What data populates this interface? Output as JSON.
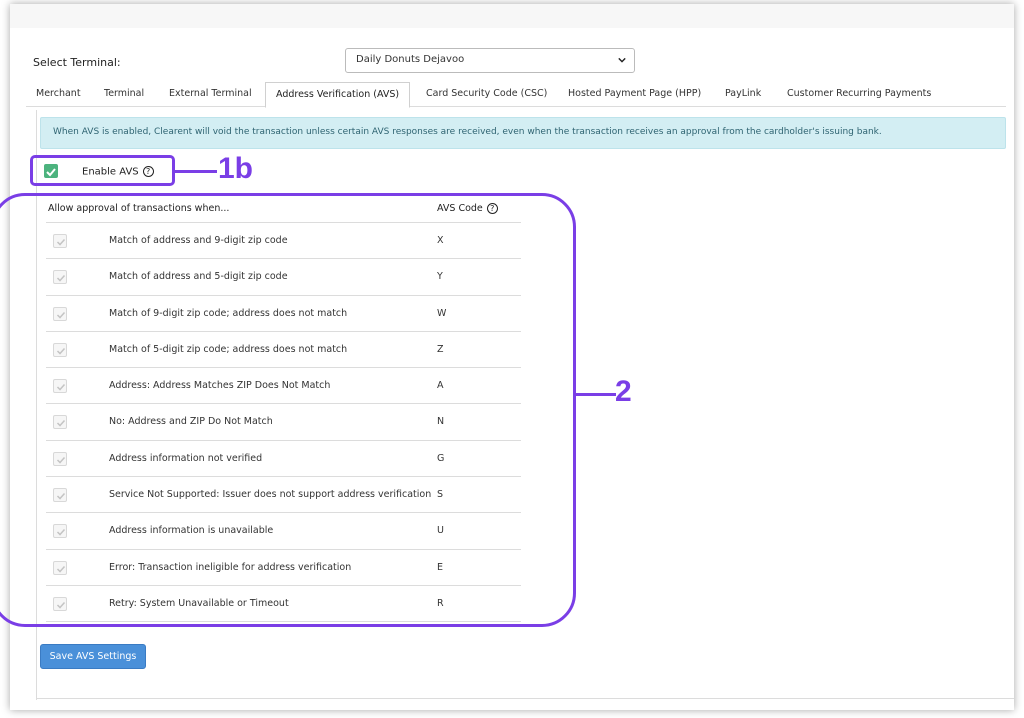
{
  "select_terminal": {
    "label": "Select Terminal:",
    "value": "Daily Donuts Dejavoo"
  },
  "tabs": [
    {
      "label": "Merchant",
      "active": false
    },
    {
      "label": "Terminal",
      "active": false
    },
    {
      "label": "External Terminal",
      "active": false
    },
    {
      "label": "Address Verification (AVS)",
      "active": true
    },
    {
      "label": "Card Security Code (CSC)",
      "active": false
    },
    {
      "label": "Hosted Payment Page (HPP)",
      "active": false
    },
    {
      "label": "PayLink",
      "active": false
    },
    {
      "label": "Customer Recurring Payments",
      "active": false
    }
  ],
  "info_message": "When AVS is enabled, Clearent will void the transaction unless certain AVS responses are received, even when the transaction receives an approval from the cardholder's issuing bank.",
  "enable_avs": {
    "label": "Enable AVS",
    "checked": true
  },
  "table": {
    "header_description": "Allow approval of transactions when...",
    "header_code": "AVS Code",
    "rows": [
      {
        "description": "Match of address and 9-digit zip code",
        "code": "X",
        "checked": true
      },
      {
        "description": "Match of address and 5-digit zip code",
        "code": "Y",
        "checked": true
      },
      {
        "description": "Match of 9-digit zip code; address does not match",
        "code": "W",
        "checked": true
      },
      {
        "description": "Match of 5-digit zip code; address does not match",
        "code": "Z",
        "checked": true
      },
      {
        "description": "Address: Address Matches ZIP Does Not Match",
        "code": "A",
        "checked": true
      },
      {
        "description": "No: Address and ZIP Do Not Match",
        "code": "N",
        "checked": true
      },
      {
        "description": "Address information not verified",
        "code": "G",
        "checked": true
      },
      {
        "description": "Service Not Supported: Issuer does not support address verification",
        "code": "S",
        "checked": true
      },
      {
        "description": "Address information is unavailable",
        "code": "U",
        "checked": true
      },
      {
        "description": "Error: Transaction ineligible for address verification",
        "code": "E",
        "checked": true
      },
      {
        "description": "Retry: System Unavailable or Timeout",
        "code": "R",
        "checked": true
      }
    ]
  },
  "save_button": "Save AVS Settings",
  "annotations": {
    "callout_1b": "1b",
    "callout_2": "2"
  },
  "colors": {
    "annotation": "#7a3ee6",
    "info_bg": "#d3eef3",
    "checkbox_green": "#4cb37e",
    "button_blue": "#4a90d9"
  }
}
